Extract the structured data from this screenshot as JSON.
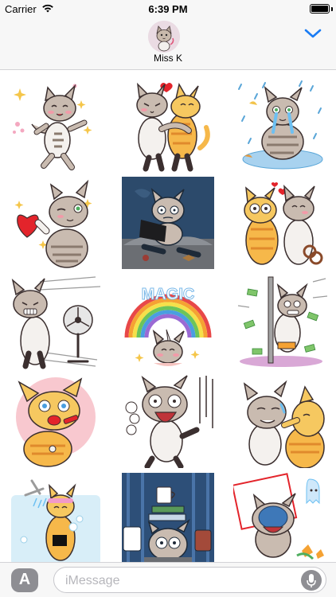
{
  "status_bar": {
    "carrier": "Carrier",
    "time": "6:39 PM",
    "battery_level": 1.0
  },
  "header": {
    "contact_name": "Miss K",
    "avatar_icon": "cat-avatar-icon",
    "collapse_icon": "chevron-down-icon",
    "accent_color": "#1a7cf4"
  },
  "stickers": [
    {
      "name": "sticker-cat-dancing-happy",
      "row": 1,
      "col": 1
    },
    {
      "name": "sticker-cats-hugging",
      "row": 1,
      "col": 2
    },
    {
      "name": "sticker-cat-crying-rain",
      "row": 1,
      "col": 3
    },
    {
      "name": "sticker-cat-winking-heart",
      "row": 2,
      "col": 1
    },
    {
      "name": "sticker-cat-laptop-night",
      "row": 2,
      "col": 2
    },
    {
      "name": "sticker-cats-shy-handcuffs",
      "row": 2,
      "col": 3
    },
    {
      "name": "sticker-cat-fan-wind",
      "row": 3,
      "col": 1
    },
    {
      "name": "sticker-cat-magic-rainbow",
      "row": 3,
      "col": 2
    },
    {
      "name": "sticker-cat-pole-money",
      "row": 3,
      "col": 3
    },
    {
      "name": "sticker-cat-lipstick",
      "row": 4,
      "col": 1
    },
    {
      "name": "sticker-cat-screaming",
      "row": 4,
      "col": 2
    },
    {
      "name": "sticker-cats-cheek-hug",
      "row": 4,
      "col": 3
    },
    {
      "name": "sticker-cat-shower",
      "row": 5,
      "col": 1
    },
    {
      "name": "sticker-cat-coffee-books",
      "row": 5,
      "col": 2
    },
    {
      "name": "sticker-cat-ghost-spill",
      "row": 5,
      "col": 3
    }
  ],
  "sticker_text": {
    "magic": "MAGIC"
  },
  "input_bar": {
    "apps_icon": "app-store-icon",
    "apps_glyph": "A",
    "placeholder": "iMessage",
    "mic_icon": "microphone-icon"
  }
}
